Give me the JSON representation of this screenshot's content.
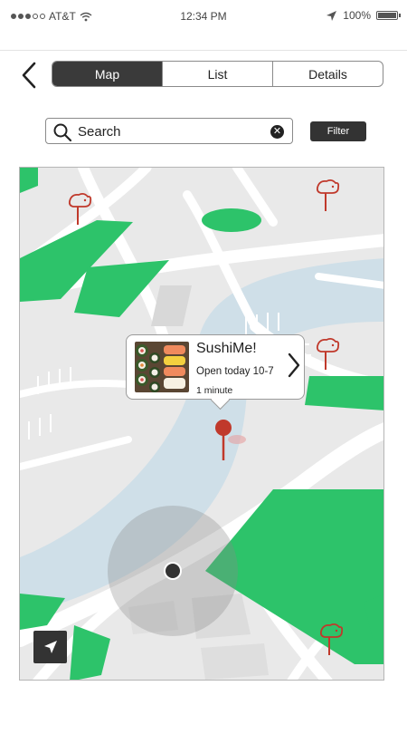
{
  "status_bar": {
    "carrier": "AT&T",
    "time": "12:34 PM",
    "battery": "100%",
    "signal_bars_filled": 3,
    "signal_bars_total": 5,
    "battery_level": 1.0
  },
  "nav": {
    "back_icon": "chevron-left-icon",
    "tabs": [
      {
        "label": "Map",
        "active": true
      },
      {
        "label": "List",
        "active": false
      },
      {
        "label": "Details",
        "active": false
      }
    ]
  },
  "search": {
    "placeholder": "Search",
    "value": "",
    "filter_label": "Filter"
  },
  "map": {
    "callout": {
      "name": "SushiMe!",
      "hours": "Open today 10-7",
      "eta": "1 minute"
    }
  },
  "colors": {
    "accent_dark": "#333333",
    "park_green": "#2dc36a",
    "water_blue": "#cfdfe8",
    "pin_red": "#c0392b",
    "road": "#ffffff",
    "land": "#e9e9e9"
  }
}
